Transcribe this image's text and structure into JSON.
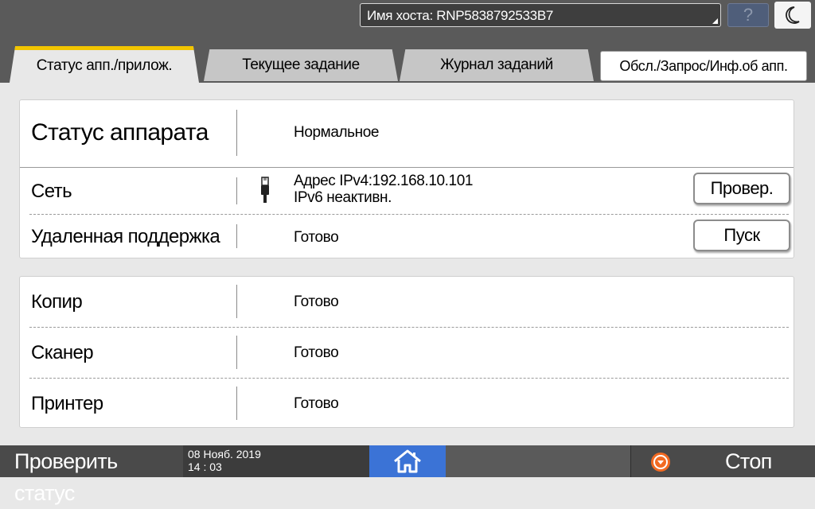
{
  "header": {
    "hostname": "Имя хоста: RNP5838792533B7",
    "help_label": "?",
    "moon_icon": "moon-icon"
  },
  "tabs": [
    {
      "label": "Статус апп./прилож.",
      "active": true
    },
    {
      "label": "Текущее задание"
    },
    {
      "label": "Журнал заданий"
    },
    {
      "label": "Обсл./Запрос/Инф.об апп."
    }
  ],
  "machine_panel": {
    "status_label": "Статус аппарата",
    "status_value": "Нормальное",
    "network_label": "Сеть",
    "network_icon": "ethernet-cable-icon",
    "network_ipv4": "Адрес IPv4:192.168.10.101",
    "network_ipv6": "IPv6 неактивн.",
    "check_button": "Провер.",
    "remote_label": "Удаленная поддержка",
    "remote_value": "Готово",
    "start_button": "Пуск"
  },
  "functions_panel": {
    "items": [
      {
        "label": "Копир",
        "value": "Готово"
      },
      {
        "label": "Сканер",
        "value": "Готово"
      },
      {
        "label": "Принтер",
        "value": "Готово"
      }
    ]
  },
  "footer": {
    "check_status": "Проверить статус",
    "date": "08 Нояб. 2019",
    "time": "14 : 03",
    "home_icon": "home-icon",
    "stop_icon": "stop-icon",
    "stop_label": "Стоп"
  },
  "colors": {
    "bar_bg": "#5a5a5a",
    "tab_accent": "#f2c500",
    "home_blue": "#3b73d6",
    "stop_orange": "#f26a22"
  }
}
